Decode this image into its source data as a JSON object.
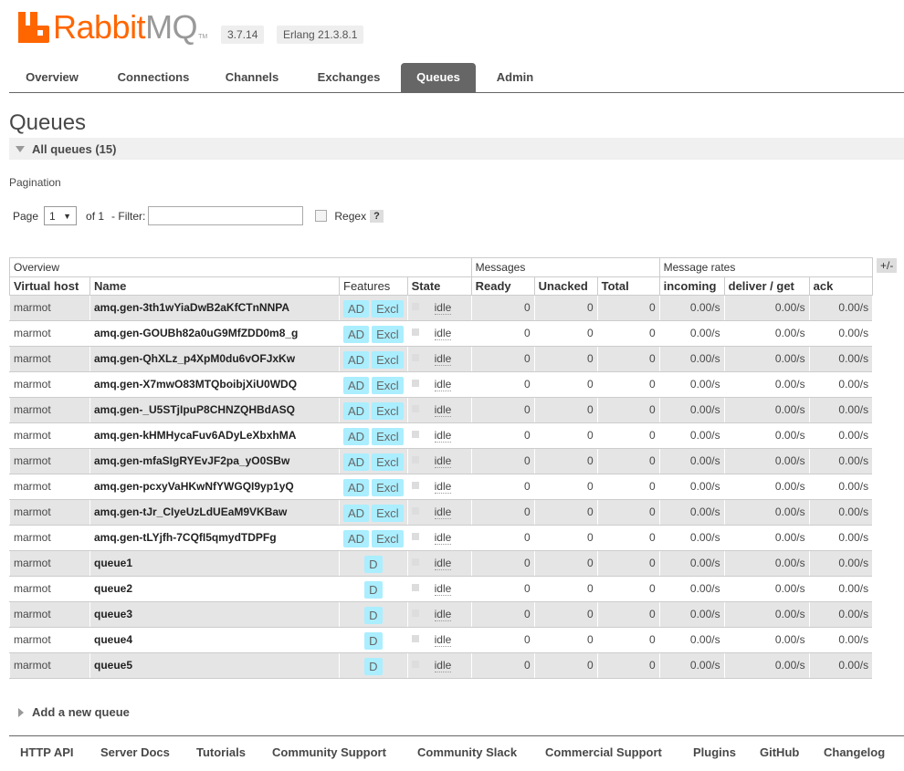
{
  "header": {
    "logo_rabbit": "Rabbit",
    "logo_mq": "MQ",
    "logo_tm": "TM",
    "version": "3.7.14",
    "erlang": "Erlang 21.3.8.1"
  },
  "nav": {
    "tabs": [
      "Overview",
      "Connections",
      "Channels",
      "Exchanges",
      "Queues",
      "Admin"
    ],
    "active": "Queues"
  },
  "page": {
    "title": "Queues",
    "section": "All queues (15)",
    "pagination_title": "Pagination",
    "page_label": "Page",
    "page_value": "1",
    "of_label": "of 1",
    "filter_label": "- Filter:",
    "filter_value": "",
    "regex_label": "Regex",
    "help": "?",
    "plusminus": "+/-"
  },
  "table": {
    "groups": [
      "Overview",
      "Messages",
      "Message rates"
    ],
    "columns": [
      "Virtual host",
      "Name",
      "Features",
      "State",
      "Ready",
      "Unacked",
      "Total",
      "incoming",
      "deliver / get",
      "ack"
    ],
    "rows": [
      {
        "vhost": "marmot",
        "name": "amq.gen-3th1wYiaDwB2aKfCTnNNPA",
        "features": [
          "AD",
          "Excl"
        ],
        "state": "idle",
        "ready": "0",
        "unacked": "0",
        "total": "0",
        "incoming": "0.00/s",
        "deliver": "0.00/s",
        "ack": "0.00/s"
      },
      {
        "vhost": "marmot",
        "name": "amq.gen-GOUBh82a0uG9MfZDD0m8_g",
        "features": [
          "AD",
          "Excl"
        ],
        "state": "idle",
        "ready": "0",
        "unacked": "0",
        "total": "0",
        "incoming": "0.00/s",
        "deliver": "0.00/s",
        "ack": "0.00/s"
      },
      {
        "vhost": "marmot",
        "name": "amq.gen-QhXLz_p4XpM0du6vOFJxKw",
        "features": [
          "AD",
          "Excl"
        ],
        "state": "idle",
        "ready": "0",
        "unacked": "0",
        "total": "0",
        "incoming": "0.00/s",
        "deliver": "0.00/s",
        "ack": "0.00/s"
      },
      {
        "vhost": "marmot",
        "name": "amq.gen-X7mwO83MTQboibjXiU0WDQ",
        "features": [
          "AD",
          "Excl"
        ],
        "state": "idle",
        "ready": "0",
        "unacked": "0",
        "total": "0",
        "incoming": "0.00/s",
        "deliver": "0.00/s",
        "ack": "0.00/s"
      },
      {
        "vhost": "marmot",
        "name": "amq.gen-_U5STjIpuP8CHNZQHBdASQ",
        "features": [
          "AD",
          "Excl"
        ],
        "state": "idle",
        "ready": "0",
        "unacked": "0",
        "total": "0",
        "incoming": "0.00/s",
        "deliver": "0.00/s",
        "ack": "0.00/s"
      },
      {
        "vhost": "marmot",
        "name": "amq.gen-kHMHycaFuv6ADyLeXbxhMA",
        "features": [
          "AD",
          "Excl"
        ],
        "state": "idle",
        "ready": "0",
        "unacked": "0",
        "total": "0",
        "incoming": "0.00/s",
        "deliver": "0.00/s",
        "ack": "0.00/s"
      },
      {
        "vhost": "marmot",
        "name": "amq.gen-mfaSIgRYEvJF2pa_yO0SBw",
        "features": [
          "AD",
          "Excl"
        ],
        "state": "idle",
        "ready": "0",
        "unacked": "0",
        "total": "0",
        "incoming": "0.00/s",
        "deliver": "0.00/s",
        "ack": "0.00/s"
      },
      {
        "vhost": "marmot",
        "name": "amq.gen-pcxyVaHKwNfYWGQI9yp1yQ",
        "features": [
          "AD",
          "Excl"
        ],
        "state": "idle",
        "ready": "0",
        "unacked": "0",
        "total": "0",
        "incoming": "0.00/s",
        "deliver": "0.00/s",
        "ack": "0.00/s"
      },
      {
        "vhost": "marmot",
        "name": "amq.gen-tJr_CIyeUzLdUEaM9VKBaw",
        "features": [
          "AD",
          "Excl"
        ],
        "state": "idle",
        "ready": "0",
        "unacked": "0",
        "total": "0",
        "incoming": "0.00/s",
        "deliver": "0.00/s",
        "ack": "0.00/s"
      },
      {
        "vhost": "marmot",
        "name": "amq.gen-tLYjfh-7CQfI5qmydTDPFg",
        "features": [
          "AD",
          "Excl"
        ],
        "state": "idle",
        "ready": "0",
        "unacked": "0",
        "total": "0",
        "incoming": "0.00/s",
        "deliver": "0.00/s",
        "ack": "0.00/s"
      },
      {
        "vhost": "marmot",
        "name": "queue1",
        "features": [
          "D"
        ],
        "state": "idle",
        "ready": "0",
        "unacked": "0",
        "total": "0",
        "incoming": "0.00/s",
        "deliver": "0.00/s",
        "ack": "0.00/s"
      },
      {
        "vhost": "marmot",
        "name": "queue2",
        "features": [
          "D"
        ],
        "state": "idle",
        "ready": "0",
        "unacked": "0",
        "total": "0",
        "incoming": "0.00/s",
        "deliver": "0.00/s",
        "ack": "0.00/s"
      },
      {
        "vhost": "marmot",
        "name": "queue3",
        "features": [
          "D"
        ],
        "state": "idle",
        "ready": "0",
        "unacked": "0",
        "total": "0",
        "incoming": "0.00/s",
        "deliver": "0.00/s",
        "ack": "0.00/s"
      },
      {
        "vhost": "marmot",
        "name": "queue4",
        "features": [
          "D"
        ],
        "state": "idle",
        "ready": "0",
        "unacked": "0",
        "total": "0",
        "incoming": "0.00/s",
        "deliver": "0.00/s",
        "ack": "0.00/s"
      },
      {
        "vhost": "marmot",
        "name": "queue5",
        "features": [
          "D"
        ],
        "state": "idle",
        "ready": "0",
        "unacked": "0",
        "total": "0",
        "incoming": "0.00/s",
        "deliver": "0.00/s",
        "ack": "0.00/s"
      }
    ]
  },
  "add_queue": "Add a new queue",
  "footer": {
    "links": [
      "HTTP API",
      "Server Docs",
      "Tutorials",
      "Community Support",
      "Community Slack",
      "Commercial Support",
      "Plugins",
      "GitHub",
      "Changelog"
    ]
  },
  "colors": {
    "brand": "#ff6600",
    "nav_active": "#666666",
    "badge": "#aaeeff"
  }
}
